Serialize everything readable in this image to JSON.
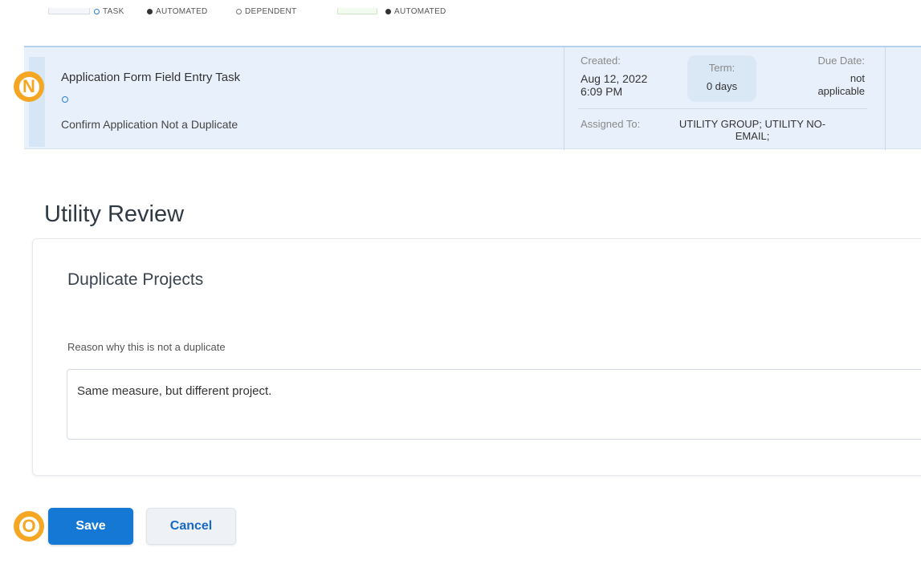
{
  "legend": {
    "task": "TASK",
    "automated": "AUTOMATED",
    "dependent": "DEPENDENT",
    "automated_2": "AUTOMATED"
  },
  "task": {
    "title": "Application Form Field Entry Task",
    "subtitle": "Confirm Application Not a Duplicate",
    "created_label": "Created:",
    "created_date": "Aug 12, 2022",
    "created_time": "6:09 PM",
    "term_label": "Term:",
    "term_value": "0 days",
    "due_label": "Due Date:",
    "due_value_1": "not",
    "due_value_2": "applicable",
    "assigned_label": "Assigned To:",
    "assigned_value_1": "UTILITY GROUP; UTILITY NO-",
    "assigned_value_2": "EMAIL;"
  },
  "badges": {
    "n": "N",
    "o": "O"
  },
  "section": {
    "title": "Utility Review",
    "card_title": "Duplicate Projects",
    "field_label": "Reason why this is not a duplicate",
    "field_value": "Same measure, but different project."
  },
  "buttons": {
    "save": "Save",
    "cancel": "Cancel"
  },
  "colors": {
    "accent": "#1478d4",
    "badge": "#f5a623",
    "task_row_bg": "#e8f1fb"
  }
}
